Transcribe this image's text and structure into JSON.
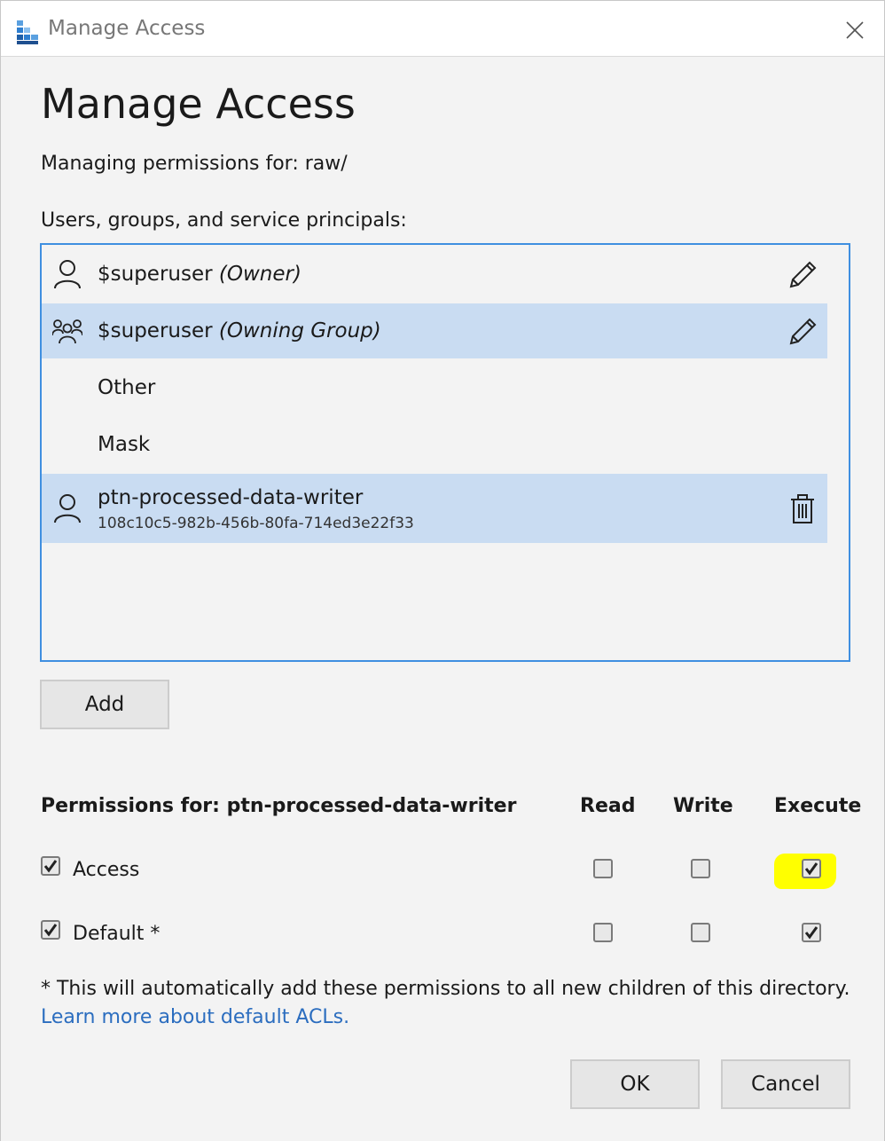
{
  "window": {
    "title": "Manage Access"
  },
  "dialog": {
    "heading": "Manage Access",
    "managing_text": "Managing permissions for: raw/",
    "list_label": "Users, groups, and service principals:"
  },
  "principals": [
    {
      "name": "$superuser",
      "role": "(Owner)",
      "icon": "user-icon",
      "action": "pencil-icon"
    },
    {
      "name": "$superuser",
      "role": "(Owning Group)",
      "icon": "group-icon",
      "action": "pencil-icon"
    },
    {
      "name": "Other"
    },
    {
      "name": "Mask"
    },
    {
      "name": "ptn-processed-data-writer",
      "id": "108c10c5-982b-456b-80fa-714ed3e22f33",
      "icon": "user-icon",
      "action": "trash-icon"
    }
  ],
  "buttons": {
    "add": "Add",
    "ok": "OK",
    "cancel": "Cancel"
  },
  "permissions": {
    "title": "Permissions for: ptn-processed-data-writer",
    "columns": [
      "Read",
      "Write",
      "Execute"
    ],
    "rows": [
      {
        "label": "Access",
        "enabled": true,
        "read": false,
        "write": false,
        "execute": true
      },
      {
        "label": "Default *",
        "enabled": true,
        "read": false,
        "write": false,
        "execute": true
      }
    ]
  },
  "footnote": "* This will automatically add these permissions to all new children of this directory.",
  "learn_more": "Learn more about default ACLs.",
  "colors": {
    "selection": "#c9dcf2",
    "listbox_border": "#3f8fe0",
    "link": "#2b6dbf",
    "highlight": "#ffff00"
  }
}
